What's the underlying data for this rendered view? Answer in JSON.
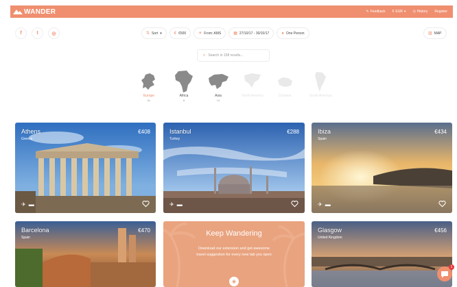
{
  "brand": {
    "name": "WANDER",
    "color": "#ef8f6f"
  },
  "nav": {
    "links": [
      {
        "label": "Feedback",
        "icon": "pencil-icon"
      },
      {
        "label": "EUR",
        "icon": "euro-icon"
      },
      {
        "label": "History",
        "icon": "clock-icon"
      },
      {
        "label": "Register",
        "icon": ""
      }
    ]
  },
  "social": [
    {
      "glyph": "f",
      "icon": "facebook-icon"
    },
    {
      "glyph": "t",
      "icon": "twitter-icon"
    },
    {
      "glyph": "◎",
      "icon": "instagram-icon"
    }
  ],
  "filters": [
    {
      "label": "Sort",
      "icon": "sort-icon",
      "glyph": "⇅"
    },
    {
      "label": "€500",
      "icon": "budget-icon",
      "glyph": "€"
    },
    {
      "label": "From: AMS",
      "icon": "plane-icon",
      "glyph": "✈"
    },
    {
      "label": "27/10/17 - 30/10/17",
      "icon": "calendar-icon",
      "glyph": "▦"
    },
    {
      "label": "One Person",
      "icon": "person-icon",
      "glyph": "●"
    }
  ],
  "map_button": {
    "label": "MAP",
    "glyph": "▥"
  },
  "search": {
    "placeholder": "Search in 158 results..."
  },
  "continents": [
    {
      "name": "Europe",
      "count": "81",
      "active": true
    },
    {
      "name": "Africa",
      "count": "8",
      "active": false
    },
    {
      "name": "Asia",
      "count": "14",
      "active": false
    },
    {
      "name": "North America",
      "count": "",
      "active": false
    },
    {
      "name": "Oceania",
      "count": "",
      "active": false
    },
    {
      "name": "South America",
      "count": "",
      "active": false
    }
  ],
  "destinations": [
    {
      "city": "Athens",
      "country": "Greece",
      "price": "€408"
    },
    {
      "city": "Istanbul",
      "country": "Turkey",
      "price": "€288"
    },
    {
      "city": "Ibiza",
      "country": "Spain",
      "price": "€434"
    },
    {
      "city": "Barcelona",
      "country": "Spain",
      "price": "€470"
    },
    {
      "city": "Glasgow",
      "country": "United Kingdom",
      "price": "€456"
    }
  ],
  "promo": {
    "title": "Keep Wandering",
    "body": "Download our extension and get awesome travel suggestion for every new tab you open"
  },
  "chat": {
    "badge": "1"
  }
}
